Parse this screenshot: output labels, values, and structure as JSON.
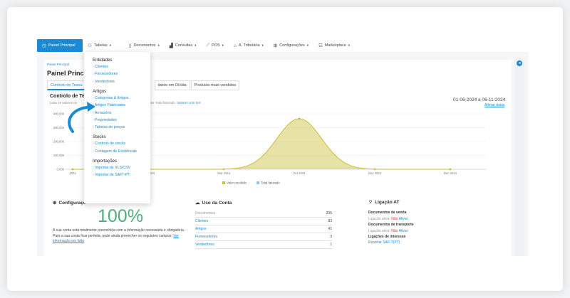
{
  "nav": {
    "items": [
      {
        "label": "Painel Principal",
        "icon": "clock-icon",
        "glyph": "◷",
        "chev": false
      },
      {
        "label": "Tabelas",
        "icon": "user-icon",
        "glyph": "⚇",
        "chev": true
      },
      {
        "label": "Documentos",
        "icon": "document-icon",
        "glyph": "▯",
        "chev": true
      },
      {
        "label": "Consultas",
        "icon": "bar-chart-icon",
        "glyph": "▟",
        "chev": true
      },
      {
        "label": "POS",
        "icon": "pos-icon",
        "glyph": "⟋",
        "chev": true
      },
      {
        "label": "A. Tributária",
        "icon": "bank-icon",
        "glyph": "⌂",
        "chev": true
      },
      {
        "label": "Configurações",
        "icon": "settings-icon",
        "glyph": "⊞",
        "chev": true
      },
      {
        "label": "Marketplace",
        "icon": "marketplace-icon",
        "glyph": "☷",
        "chev": true
      }
    ]
  },
  "breadcrumb": "Painel Principal",
  "page_title": "Painel Princip",
  "tabs": [
    {
      "label": "Controlo de Tesou",
      "active": true
    },
    {
      "label": "dante em Dívida",
      "active": false
    },
    {
      "label": "Produtos mais vendidos",
      "active": false
    }
  ],
  "section": {
    "title": "Controlo de Te",
    "subtitle_left": "Lista os valores do",
    "subtitle_right": "pago e o valor Total faturado.",
    "subtitle_link": "Valores com IVA",
    "date_range": "01-06-2024 a 06-11-2024",
    "alter_link": "Alterar datas"
  },
  "chart_data": {
    "type": "area",
    "x": [
      "Jul 2024",
      "Aug 2024",
      "Sep 2024",
      "Oct 2024",
      "Nov 2024",
      "Dec 2024"
    ],
    "tick_labels": [
      "2024",
      "Aug 2024",
      "Sep 2024",
      "Oct 2024",
      "Nov 2024",
      "Dec 2024"
    ],
    "series": [
      {
        "name": "Valor recebido",
        "color": "#c9bf3a",
        "values": [
          0,
          0,
          0,
          365000,
          0,
          0
        ]
      },
      {
        "name": "Total faturado",
        "color": "#8ecae6",
        "values": [
          0,
          0,
          0,
          0,
          0,
          0
        ]
      }
    ],
    "y_ticks": [
      "400,00€",
      "300,00€",
      "200,00€",
      "100,00€",
      "0,00€"
    ],
    "ylim": [
      0,
      400000
    ],
    "legend": "bottom-center",
    "grid": true
  },
  "config": {
    "title": "Configuraçõ",
    "percent": "100%",
    "text1": "A sua conta está totalmente preenchida com a informação necessária e obrigatória.",
    "text2": "Para a sua conta ficar perfeita, pode ainda preencher os seguintes campos:",
    "link": "Ver informação em falta"
  },
  "uso": {
    "title": "Uso da Conta",
    "rows": [
      {
        "label": "Documentos",
        "value": "235",
        "link": false
      },
      {
        "label": "Clientes",
        "value": "83",
        "link": true
      },
      {
        "label": "Artigos",
        "value": "41",
        "link": true
      },
      {
        "label": "Fornecedores",
        "value": "3",
        "link": true
      },
      {
        "label": "Vendedores",
        "value": "1",
        "link": true
      }
    ]
  },
  "at": {
    "title": "Ligação AT",
    "docs_venda": "Documentos de venda",
    "docs_transp": "Documentos de transporte",
    "ligacao_ativa": "Ligação ativa:",
    "nao": "Não",
    "ativar": "Ativar",
    "ligacoes": "Ligações de interesse",
    "exportar": "Exportar SAF-T(PT)"
  },
  "dropdown": {
    "groups": [
      {
        "title": "Entidades",
        "items": [
          "Clientes",
          "Fornecedores",
          "Vendedores"
        ]
      },
      {
        "title": "Artigos",
        "items": [
          "Categorias & Artigos",
          "Artigos Fabricados",
          "Armazéns",
          "Propriedades",
          "Tabelas de preços"
        ]
      },
      {
        "title": "Stocks",
        "items": [
          "Controlo de stocks",
          "Contagem de Existências"
        ]
      },
      {
        "title": "Importações",
        "items": [
          "Importar de XLS/CSV",
          "Importar de SAFT-PT"
        ]
      }
    ]
  }
}
